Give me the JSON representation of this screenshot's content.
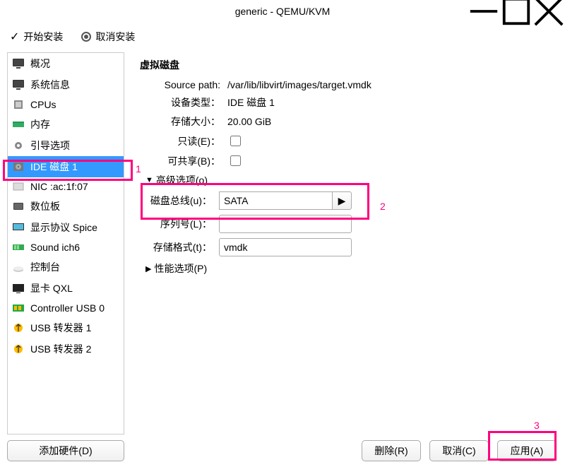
{
  "title": "generic - QEMU/KVM",
  "toolbar": {
    "begin_install": "开始安装",
    "cancel_install": "取消安装"
  },
  "sidebar": {
    "items": [
      {
        "label": "概况",
        "icon": "monitor-icon"
      },
      {
        "label": "系统信息",
        "icon": "monitor-icon"
      },
      {
        "label": "CPUs",
        "icon": "cpu-icon"
      },
      {
        "label": "内存",
        "icon": "ram-icon"
      },
      {
        "label": "引导选项",
        "icon": "gear-icon"
      },
      {
        "label": "IDE 磁盘 1",
        "icon": "disk-icon",
        "selected": true
      },
      {
        "label": "NIC :ac:1f:07",
        "icon": "nic-icon"
      },
      {
        "label": "数位板",
        "icon": "tablet-icon"
      },
      {
        "label": "显示协议 Spice",
        "icon": "display-icon"
      },
      {
        "label": "Sound ich6",
        "icon": "sound-icon"
      },
      {
        "label": "控制台",
        "icon": "console-icon"
      },
      {
        "label": "显卡 QXL",
        "icon": "video-icon"
      },
      {
        "label": "Controller USB 0",
        "icon": "usb-controller-icon"
      },
      {
        "label": "USB 转发器 1",
        "icon": "usb-redirect-icon"
      },
      {
        "label": "USB 转发器 2",
        "icon": "usb-redirect-icon"
      }
    ],
    "add_hardware": "添加硬件(D)"
  },
  "main": {
    "section_title": "虚拟磁盘",
    "fields": {
      "source_path_label": "Source path:",
      "source_path_value": "/var/lib/libvirt/images/target.vmdk",
      "device_type_label": "设备类型：",
      "device_type_value": "IDE 磁盘 1",
      "storage_size_label": "存储大小：",
      "storage_size_value": "20.00 GiB",
      "readonly_label": "只读(E)：",
      "shareable_label": "可共享(B)："
    },
    "advanced": {
      "header": "高级选项(o)",
      "disk_bus_label": "磁盘总线(u)：",
      "disk_bus_value": "SATA",
      "serial_label": "序列号(L)：",
      "serial_value": "",
      "storage_format_label": "存储格式(t)：",
      "storage_format_value": "vmdk"
    },
    "performance_header": "性能选项(P)"
  },
  "footer": {
    "delete": "删除(R)",
    "cancel": "取消(C)",
    "apply": "应用(A)"
  },
  "annotations": {
    "a1": "1",
    "a2": "2",
    "a3": "3"
  }
}
